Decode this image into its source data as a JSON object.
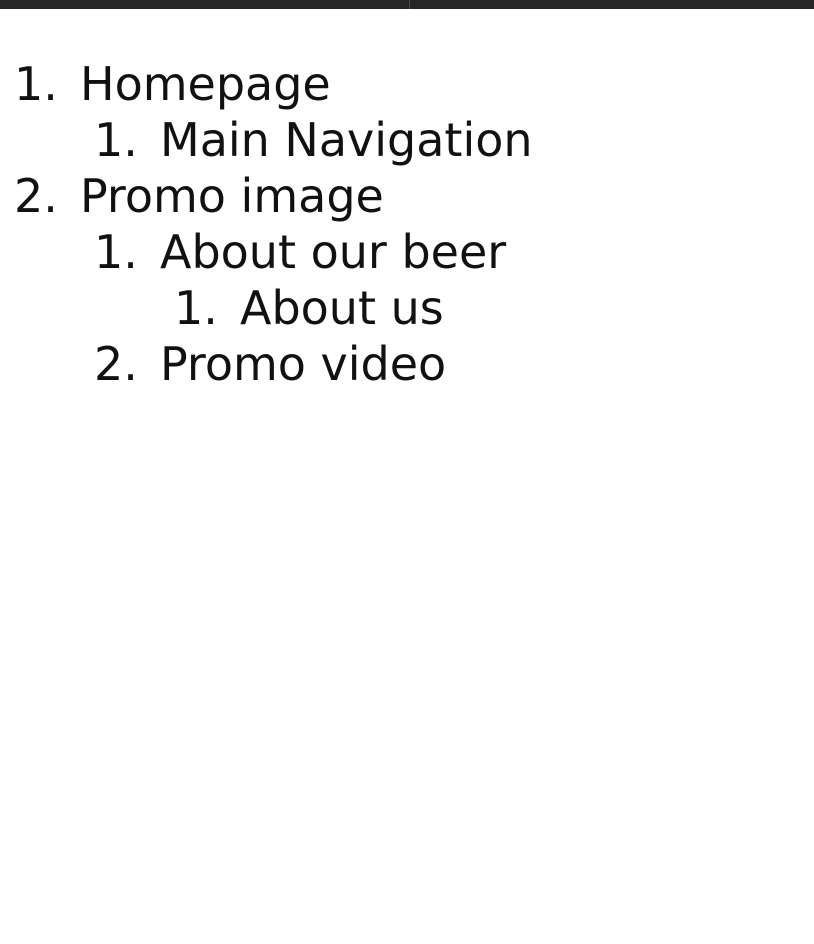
{
  "outline": [
    {
      "number": "1.",
      "label": "Homepage",
      "children": [
        {
          "number": "1.",
          "label": "Main Navigation"
        }
      ]
    },
    {
      "number": "2.",
      "label": "Promo image",
      "children": [
        {
          "number": "1.",
          "label": "About our beer",
          "children": [
            {
              "number": "1.",
              "label": "About us"
            }
          ]
        },
        {
          "number": "2.",
          "label": "Promo video"
        }
      ]
    }
  ]
}
